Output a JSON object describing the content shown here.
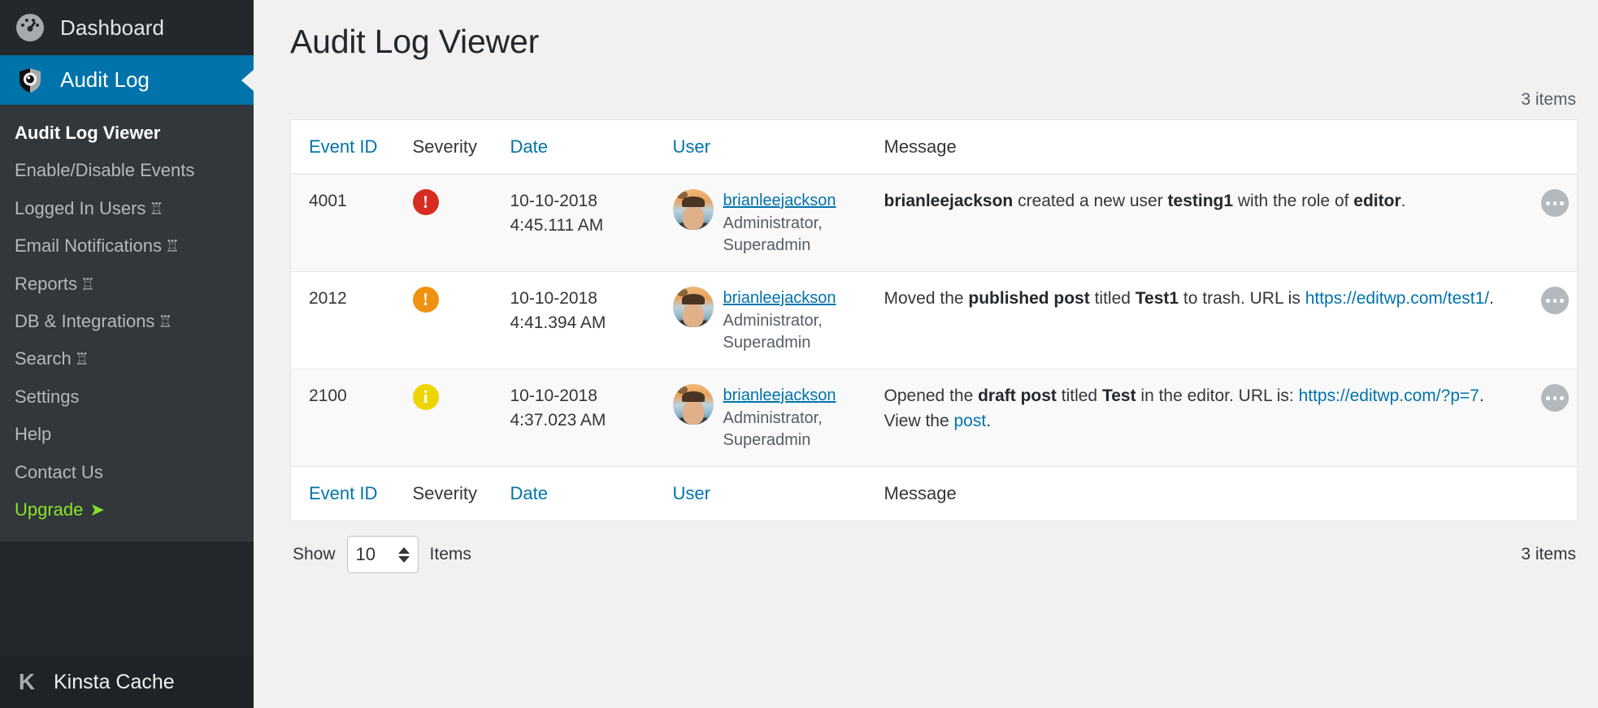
{
  "sidebar": {
    "top_item": {
      "label": "Dashboard",
      "icon": "dashboard-icon"
    },
    "active_item": {
      "label": "Audit Log",
      "icon": "shield-eye-icon"
    },
    "submenu": [
      {
        "label": "Audit Log Viewer",
        "current": true,
        "premium": false
      },
      {
        "label": "Enable/Disable Events",
        "current": false,
        "premium": false
      },
      {
        "label": "Logged In Users",
        "current": false,
        "premium": true
      },
      {
        "label": "Email Notifications",
        "current": false,
        "premium": true
      },
      {
        "label": "Reports",
        "current": false,
        "premium": true
      },
      {
        "label": "DB & Integrations",
        "current": false,
        "premium": true
      },
      {
        "label": "Search",
        "current": false,
        "premium": true
      },
      {
        "label": "Settings",
        "current": false,
        "premium": false
      },
      {
        "label": "Help",
        "current": false,
        "premium": false
      },
      {
        "label": "Contact Us",
        "current": false,
        "premium": false
      },
      {
        "label": "Upgrade",
        "current": false,
        "premium": false,
        "upgrade": true,
        "arrow": "➤"
      }
    ],
    "premium_glyph": "♖",
    "footer": {
      "logo": "K",
      "label": "Kinsta Cache"
    }
  },
  "page": {
    "title": "Audit Log Viewer",
    "items_count_top": "3 items",
    "items_count_bottom": "3 items"
  },
  "table": {
    "columns": [
      {
        "label": "Event ID",
        "sortable": true
      },
      {
        "label": "Severity",
        "sortable": false
      },
      {
        "label": "Date",
        "sortable": true
      },
      {
        "label": "User",
        "sortable": true
      },
      {
        "label": "Message",
        "sortable": false
      }
    ],
    "rows": [
      {
        "event_id": "4001",
        "severity": {
          "level": "critical",
          "glyph": "!",
          "color": "#d62c21"
        },
        "date": "10-10-2018",
        "time": "4:45.111 AM",
        "user": {
          "name": "brianleejackson",
          "roles": "Administrator, Superadmin"
        },
        "message_parts": [
          {
            "text": "brianleejackson",
            "style": "bold"
          },
          {
            "text": " created a new user ",
            "style": "plain"
          },
          {
            "text": "testing1",
            "style": "bold"
          },
          {
            "text": " with the role of ",
            "style": "plain"
          },
          {
            "text": "editor",
            "style": "bold"
          },
          {
            "text": ".",
            "style": "plain"
          }
        ],
        "action": "row-actions-menu"
      },
      {
        "event_id": "2012",
        "severity": {
          "level": "warning",
          "glyph": "!",
          "color": "#ef9111"
        },
        "date": "10-10-2018",
        "time": "4:41.394 AM",
        "user": {
          "name": "brianleejackson",
          "roles": "Administrator, Superadmin"
        },
        "message_parts": [
          {
            "text": "Moved the ",
            "style": "plain"
          },
          {
            "text": "published post",
            "style": "bold"
          },
          {
            "text": " titled ",
            "style": "plain"
          },
          {
            "text": "Test1",
            "style": "bold"
          },
          {
            "text": " to trash. URL is ",
            "style": "plain"
          },
          {
            "text": "https://editwp.com/test1/",
            "style": "link"
          },
          {
            "text": ".",
            "style": "plain"
          }
        ],
        "action": "row-actions-menu"
      },
      {
        "event_id": "2100",
        "severity": {
          "level": "notice",
          "glyph": "i",
          "color": "#edd500"
        },
        "date": "10-10-2018",
        "time": "4:37.023 AM",
        "user": {
          "name": "brianleejackson",
          "roles": "Administrator, Superadmin"
        },
        "message_parts": [
          {
            "text": "Opened the ",
            "style": "plain"
          },
          {
            "text": "draft post",
            "style": "bold"
          },
          {
            "text": " titled ",
            "style": "plain"
          },
          {
            "text": "Test",
            "style": "bold"
          },
          {
            "text": " in the editor. URL is: ",
            "style": "plain"
          },
          {
            "text": "https://editwp.com/?p=7",
            "style": "link"
          },
          {
            "text": ". View the ",
            "style": "plain"
          },
          {
            "text": "post",
            "style": "link"
          },
          {
            "text": ".",
            "style": "plain"
          }
        ],
        "action": "row-actions-menu"
      }
    ]
  },
  "pagination": {
    "show_label": "Show",
    "per_page_value": "10",
    "items_label": "Items"
  },
  "colors": {
    "accent": "#0073aa",
    "sidebar_bg": "#23282d",
    "submenu_bg": "#32373c",
    "upgrade_green": "#8ae22a",
    "page_bg": "#f1f1f1"
  }
}
